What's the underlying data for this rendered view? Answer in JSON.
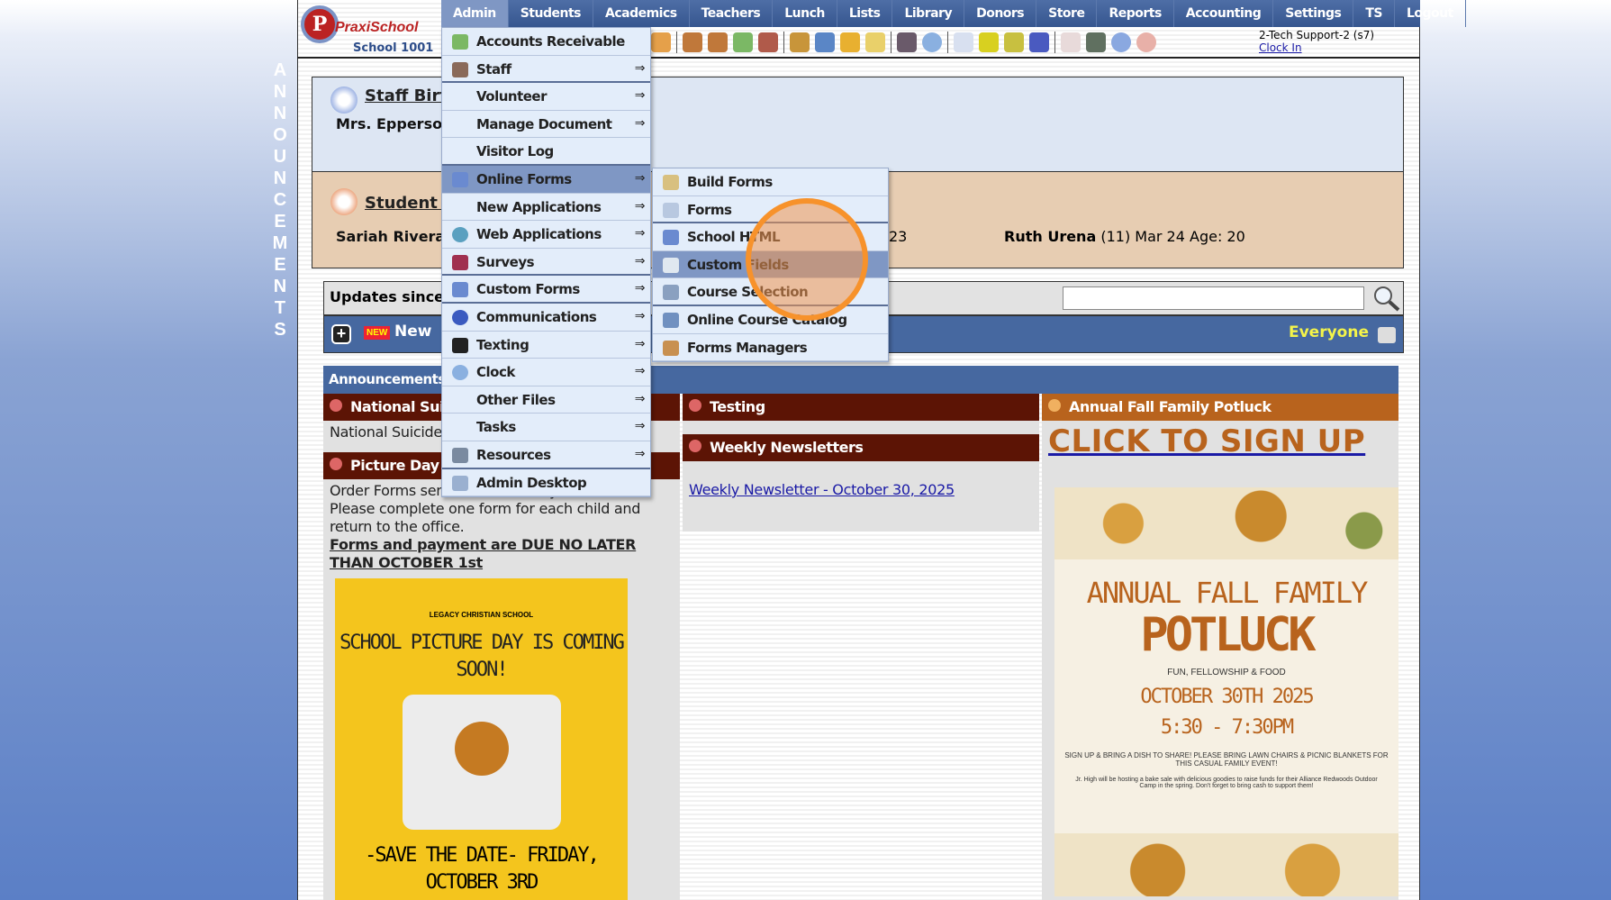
{
  "vertical_label": "ANNOUNCEMENTS",
  "logo": {
    "brand": "PraxiSchool",
    "school": "School 1001"
  },
  "nav": [
    "Admin",
    "Students",
    "Academics",
    "Teachers",
    "Lunch",
    "Lists",
    "Library",
    "Donors",
    "Store",
    "Reports",
    "Accounting",
    "Settings",
    "TS",
    "Logout"
  ],
  "user": {
    "name": "2-Tech Support-2 (s7)",
    "clock_in": "Clock In"
  },
  "colors": {
    "nav": "#3f5f95",
    "accent_orange": "#b8631d",
    "header_dark": "#5c1405",
    "highlight": "#f7922b"
  },
  "staff_birthdays": {
    "title": "Staff Birt",
    "name": "Mrs. Epperson"
  },
  "student_birthdays": {
    "title": "Student B",
    "first": "Sariah Rivera",
    "partial": "23",
    "second_name": "Ruth Urena",
    "second_detail": "(11) Mar 24 Age: 20"
  },
  "updates": {
    "label": "Updates since:",
    "search_value": ""
  },
  "newbar": {
    "badge": "NEW",
    "label": "New",
    "audience": "Everyone"
  },
  "announcements": {
    "header": "Announcements",
    "col1": {
      "h1": "National Suicide",
      "t1": "National Suicide",
      "h2": "Picture Day -",
      "t2a": "Order Forms sent home in Friday Folders.",
      "t2b": "Please complete one form for each child and return to the office.",
      "t2c": "Forms and payment are DUE NO LATER THAN OCTOBER 1st",
      "poster": {
        "school": "LEGACY CHRISTIAN SCHOOL",
        "headline": "SCHOOL PICTURE DAY IS COMING SOON!",
        "footer": "-SAVE THE DATE- FRIDAY, OCTOBER 3RD"
      }
    },
    "col2": {
      "h1": "Testing",
      "h2": "Weekly Newsletters",
      "link": "Weekly Newsletter - October 30, 2025"
    },
    "col3": {
      "h1": "Annual Fall Family Potluck",
      "signup": "CLICK TO SIGN UP",
      "poster": {
        "t1": "ANNUAL FALL FAMILY",
        "t2": "POTLUCK",
        "t3": "FUN, FELLOWSHIP & FOOD",
        "t4": "OCTOBER 30TH 2025",
        "t4b": "5:30 - 7:30PM",
        "t5": "SIGN UP & BRING A DISH TO SHARE! PLEASE BRING LAWN CHAIRS & PICNIC BLANKETS FOR THIS CASUAL FAMILY EVENT!",
        "t6": "Jr. High will be hosting a bake sale with delicious goodies to raise funds for their Alliance Redwoods Outdoor Camp in the spring. Don't forget to bring cash to support them!"
      }
    }
  },
  "admin_menu": [
    {
      "label": "Accounts Receivable",
      "icon": "money-icon",
      "arrow": ""
    },
    {
      "label": "Staff",
      "icon": "staff-icon",
      "arrow": "⇒"
    },
    {
      "label": "Volunteer",
      "icon": "",
      "arrow": "⇒"
    },
    {
      "label": "Manage Document",
      "icon": "",
      "arrow": "⇒"
    },
    {
      "label": "Visitor Log",
      "icon": "",
      "arrow": ""
    },
    {
      "label": "Online Forms",
      "icon": "html-icon",
      "arrow": "⇒"
    },
    {
      "label": "New Applications",
      "icon": "",
      "arrow": "⇒"
    },
    {
      "label": "Web Applications",
      "icon": "globe-icon",
      "arrow": "⇒"
    },
    {
      "label": "Surveys",
      "icon": "survey-icon",
      "arrow": "⇒"
    },
    {
      "label": "Custom Forms",
      "icon": "html-icon",
      "arrow": "⇒"
    },
    {
      "label": "Communications",
      "icon": "at-icon",
      "arrow": "⇒"
    },
    {
      "label": "Texting",
      "icon": "phone-icon",
      "arrow": "⇒"
    },
    {
      "label": "Clock",
      "icon": "clock-icon",
      "arrow": "⇒"
    },
    {
      "label": "Other Files",
      "icon": "",
      "arrow": "⇒"
    },
    {
      "label": "Tasks",
      "icon": "",
      "arrow": "⇒"
    },
    {
      "label": "Resources",
      "icon": "resources-icon",
      "arrow": "⇒"
    },
    {
      "label": "Admin Desktop",
      "icon": "desktop-icon",
      "arrow": ""
    }
  ],
  "online_forms_submenu": [
    {
      "label": "Build Forms",
      "icon": "build-forms-icon"
    },
    {
      "label": "Forms",
      "icon": "forms-icon"
    },
    {
      "label": "School HTML",
      "icon": "html-icon"
    },
    {
      "label": "Custom Fields",
      "icon": "custom-fields-icon"
    },
    {
      "label": "Course Selection",
      "icon": "list-icon"
    },
    {
      "label": "Online Course Catalog",
      "icon": "book-icon"
    },
    {
      "label": "Forms Managers",
      "icon": "user-edit-icon"
    }
  ]
}
